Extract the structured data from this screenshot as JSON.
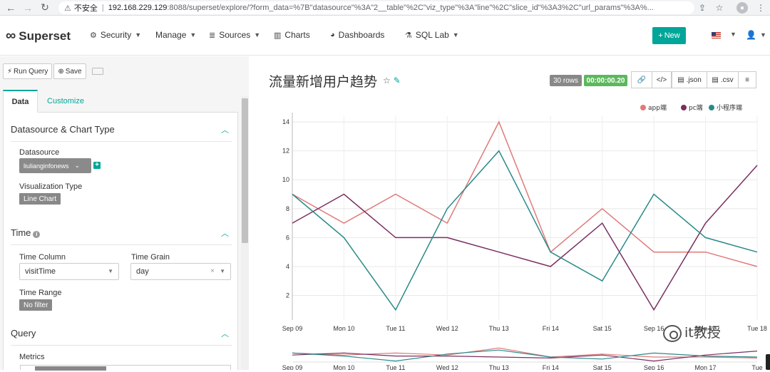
{
  "browser": {
    "security_label": "不安全",
    "url_host": "192.168.229.129",
    "url_rest": ":8088/superset/explore/?form_data=%7B\"datasource\"%3A\"2__table\"%2C\"viz_type\"%3A\"line\"%2C\"slice_id\"%3A3%2C\"url_params\"%3A%...",
    "icons": [
      "back-arrow-icon",
      "forward-arrow-icon",
      "reload-icon",
      "share-icon",
      "star-icon",
      "profile-icon",
      "menu-icon"
    ]
  },
  "navbar": {
    "brand": "Superset",
    "items": [
      {
        "label": "Security",
        "icon": "gear-icon"
      },
      {
        "label": "Manage"
      },
      {
        "label": "Sources",
        "icon": "database-icon"
      },
      {
        "label": "Charts",
        "icon": "bar-chart-icon"
      },
      {
        "label": "Dashboards",
        "icon": "dashboard-icon"
      },
      {
        "label": "SQL Lab",
        "icon": "flask-icon"
      }
    ],
    "new_button": "New"
  },
  "toolbar": {
    "run_query": "Run Query",
    "save": "Save"
  },
  "tabs": {
    "data": "Data",
    "customize": "Customize"
  },
  "sections": {
    "datasource_title": "Datasource & Chart Type",
    "datasource_label": "Datasource",
    "datasource_value": "liulianginfonews",
    "viz_type_label": "Visualization Type",
    "viz_type_value": "Line Chart",
    "time_title": "Time",
    "time_column_label": "Time Column",
    "time_column_value": "visitTime",
    "time_grain_label": "Time Grain",
    "time_grain_value": "day",
    "time_range_label": "Time Range",
    "time_range_value": "No filter",
    "query_title": "Query",
    "metrics_label": "Metrics"
  },
  "chart_header": {
    "title": "流量新增用户趋势",
    "rows_badge": "30 rows",
    "time_badge": "00:00:00.20",
    "json_btn": ".json",
    "csv_btn": ".csv"
  },
  "watermark": "it教授",
  "chart_data": {
    "type": "line",
    "categories": [
      "Sep 09",
      "Mon 10",
      "Tue 11",
      "Wed 12",
      "Thu 13",
      "Fri 14",
      "Sat 15",
      "Sep 16",
      "Mon 17",
      "Tue 18"
    ],
    "yticks": [
      2,
      4,
      6,
      8,
      10,
      12,
      14
    ],
    "ylim": [
      0.3,
      14.4
    ],
    "legend_position": "top-right",
    "grid": true,
    "series": [
      {
        "name": "app端",
        "color": "#e07a7a",
        "values": [
          9,
          7,
          9,
          7,
          14,
          5,
          8,
          5,
          5,
          4
        ]
      },
      {
        "name": "pc端",
        "color": "#7a2f60",
        "values": [
          7,
          9,
          6,
          6,
          5,
          4,
          7,
          1,
          7,
          11
        ]
      },
      {
        "name": "小程序端",
        "color": "#2a8a8a",
        "values": [
          9,
          6,
          1,
          8,
          12,
          5,
          3,
          9,
          6,
          5
        ]
      }
    ],
    "brush_axis_labels": [
      "Sep 09",
      "Mon 10",
      "Tue 11",
      "Wed 12",
      "Thu 13",
      "Fri 14",
      "Sat 15",
      "Sep 16",
      "Mon 17",
      "Tue"
    ]
  }
}
